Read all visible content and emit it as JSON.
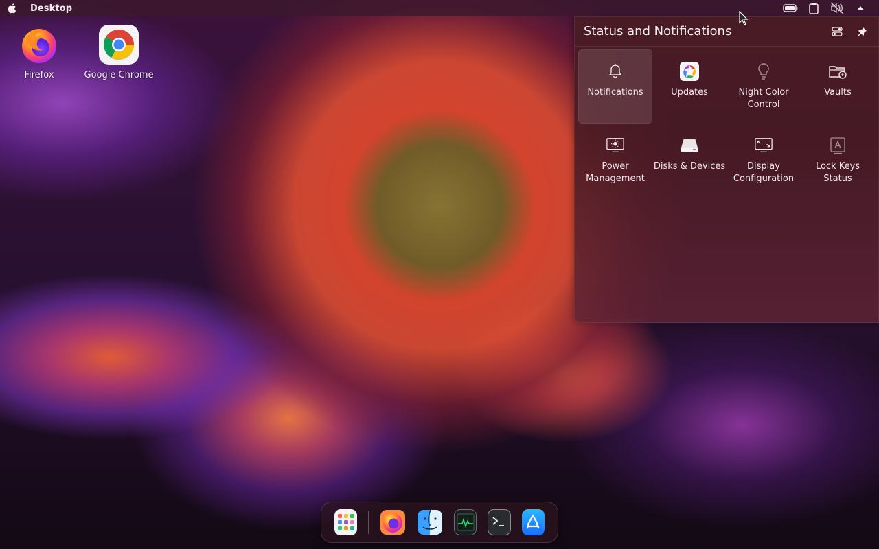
{
  "topbar": {
    "title": "Desktop",
    "apple_icon": "apple-icon",
    "tray_icons": [
      "battery-icon",
      "clipboard-icon",
      "volume-muted-icon",
      "chevron-up-icon"
    ]
  },
  "desktop_icons": [
    {
      "label": "Firefox",
      "icon": "firefox-icon"
    },
    {
      "label": "Google Chrome",
      "icon": "chrome-icon"
    }
  ],
  "panel": {
    "title": "Status and Notifications",
    "header_actions": [
      "configure-icon",
      "pin-icon"
    ],
    "tiles": [
      {
        "label": "Notifications",
        "icon": "bell-icon",
        "selected": true
      },
      {
        "label": "Updates",
        "icon": "updates-icon",
        "selected": false
      },
      {
        "label": "Night Color Control",
        "icon": "lightbulb-icon",
        "selected": false
      },
      {
        "label": "Vaults",
        "icon": "vault-icon",
        "selected": false
      },
      {
        "label": "Power Management",
        "icon": "power-management-icon",
        "selected": false
      },
      {
        "label": "Disks & Devices",
        "icon": "disk-icon",
        "selected": false
      },
      {
        "label": "Display Configuration",
        "icon": "display-icon",
        "selected": false
      },
      {
        "label": "Lock Keys Status",
        "icon": "lock-keys-icon",
        "selected": false
      }
    ]
  },
  "dock": {
    "items": [
      "app-grid-icon",
      "firefox-icon",
      "finder-icon",
      "activity-monitor-icon",
      "terminal-icon",
      "app-store-icon"
    ]
  },
  "colors": {
    "panel_bg": "#4a1c24",
    "selected_tile": "#6c4b53",
    "text": "#f1e6ed"
  }
}
